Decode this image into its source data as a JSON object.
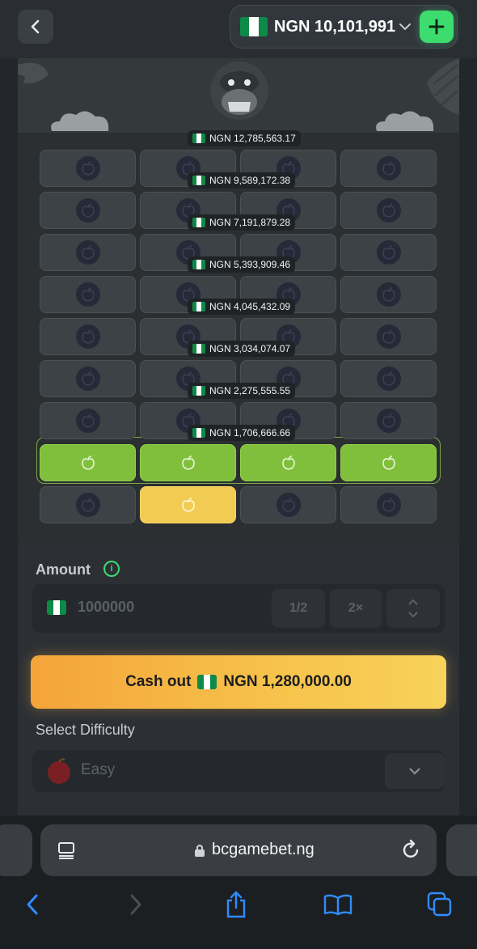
{
  "header": {
    "balance": "NGN 10,101,991.",
    "currency_flag": "nigeria-flag-icon",
    "add_label": "+"
  },
  "board": {
    "multipliers": [
      "NGN 12,785,563.17",
      "NGN 9,589,172.38",
      "NGN 7,191,879.28",
      "NGN 5,393,909.46",
      "NGN 4,045,432.09",
      "NGN 3,034,074.07",
      "NGN 2,275,555.55",
      "NGN 1,706,666.66"
    ],
    "rows": 9,
    "columns": 4,
    "completed_rows": 1,
    "winning_row_index": 7,
    "picked_tile": {
      "row": 8,
      "column": 1
    },
    "colors": {
      "win": "#7fbf3b",
      "picked": "#f2cc52",
      "tile": "#3c4245"
    }
  },
  "controls": {
    "amount_label": "Amount",
    "info_icon": "i",
    "amount_value": "1000000",
    "half_label": "1/2",
    "double_label": "2×",
    "cashout_prefix": "Cash out",
    "cashout_amount": "NGN 1,280,000.00",
    "difficulty_label": "Select Difficulty",
    "difficulty_value": "Easy"
  },
  "browser": {
    "url": "bcgamebet.ng"
  },
  "accent_colors": {
    "green": "#3ddc6e",
    "cashout": "#f7c34b",
    "ios_blue": "#2f8cff"
  }
}
